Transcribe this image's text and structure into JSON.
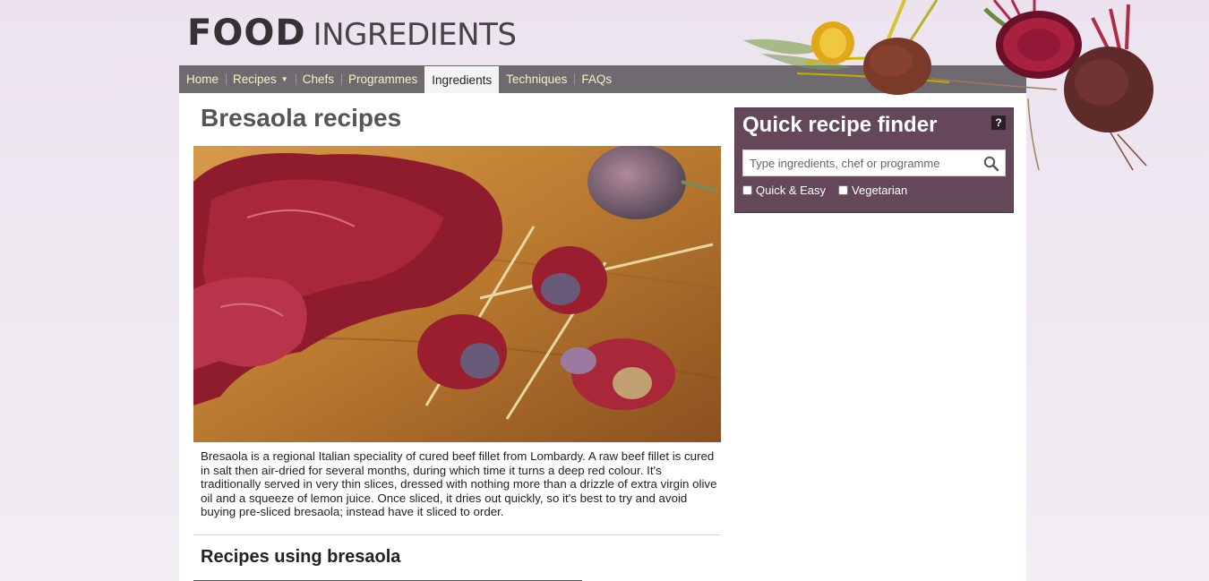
{
  "header": {
    "logo_primary": "FOOD",
    "logo_secondary": "INGREDIENTS"
  },
  "nav": {
    "items": [
      {
        "label": "Home",
        "active": false
      },
      {
        "label": "Recipes",
        "active": false,
        "has_dropdown": true
      },
      {
        "label": "Chefs",
        "active": false
      },
      {
        "label": "Programmes",
        "active": false
      },
      {
        "label": "Ingredients",
        "active": true
      },
      {
        "label": "Techniques",
        "active": false
      },
      {
        "label": "FAQs",
        "active": false
      }
    ],
    "bar_color": "#6e6a70",
    "text_color": "#f3f1cc"
  },
  "main": {
    "title": "Bresaola recipes",
    "hero_image_icon": "bresaola-figs-photo",
    "description": "Bresaola is a regional Italian speciality of cured beef fillet from Lombardy. A raw beef fillet is cured in salt then air-dried for several months, during which time it turns a deep red colour. It's traditionally served in very thin slices, dressed with nothing more than a drizzle of extra virgin olive oil and a squeeze of lemon juice. Once sliced, it dries out quickly, so it's best to try and avoid buying pre-sliced bresaola; instead have it sliced to order.",
    "recipes_heading": "Recipes using bresaola"
  },
  "finder": {
    "title": "Quick recipe finder",
    "help_label": "?",
    "search_placeholder": "Type ingredients, chef or programme",
    "search_value": "",
    "search_icon": "magnifier-icon",
    "options": [
      {
        "label": "Quick & Easy",
        "checked": false
      },
      {
        "label": "Vegetarian",
        "checked": false
      }
    ],
    "panel_color": "#64485a"
  }
}
